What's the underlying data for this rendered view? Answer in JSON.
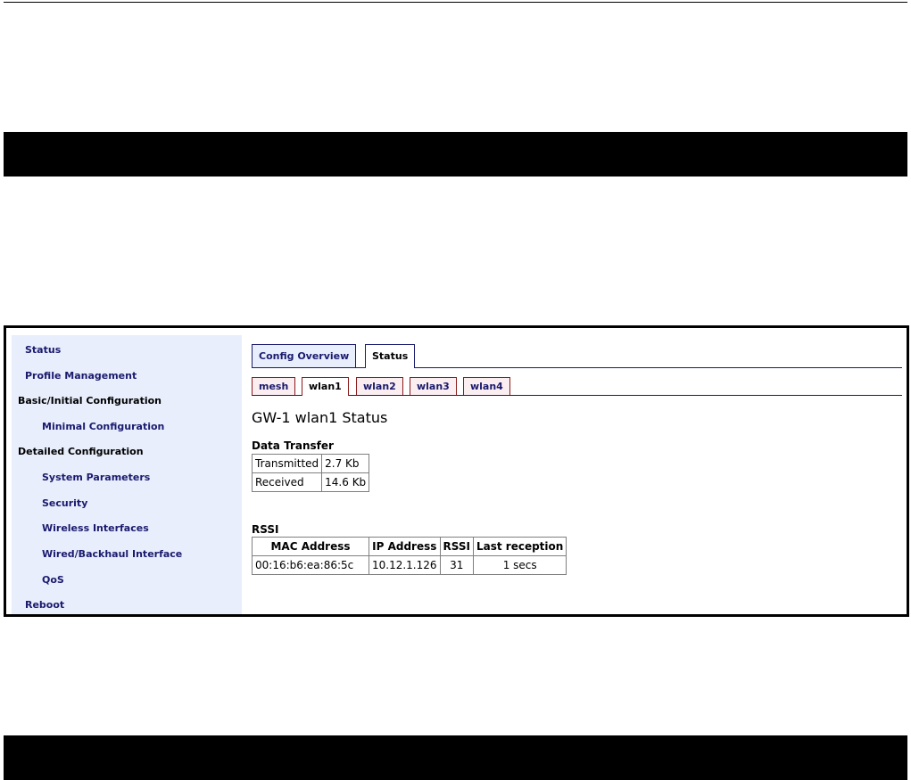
{
  "sidebar": {
    "items": [
      {
        "label": "Status"
      },
      {
        "label": "Profile Management"
      },
      {
        "label": "Basic/Initial Configuration"
      },
      {
        "label": "Minimal Configuration"
      },
      {
        "label": "Detailed Configuration"
      },
      {
        "label": "System Parameters"
      },
      {
        "label": "Security"
      },
      {
        "label": "Wireless Interfaces"
      },
      {
        "label": "Wired/Backhaul Interface"
      },
      {
        "label": "QoS"
      },
      {
        "label": "Reboot"
      }
    ]
  },
  "tabs": [
    {
      "label": "Config Overview"
    },
    {
      "label": "Status"
    }
  ],
  "active_tab": "Status",
  "subtabs": [
    {
      "label": "mesh"
    },
    {
      "label": "wlan1"
    },
    {
      "label": "wlan2"
    },
    {
      "label": "wlan3"
    },
    {
      "label": "wlan4"
    }
  ],
  "active_subtab": "wlan1",
  "page_title": "GW-1 wlan1 Status",
  "data_transfer": {
    "title": "Data Transfer",
    "rows": [
      {
        "label": "Transmitted",
        "value": "2.7 Kb"
      },
      {
        "label": "Received",
        "value": "14.6 Kb"
      }
    ]
  },
  "rssi": {
    "title": "RSSI",
    "headers": [
      "MAC Address",
      "IP Address",
      "RSSI",
      "Last reception"
    ],
    "rows": [
      [
        "00:16:b6:ea:86:5c",
        "10.12.1.126",
        "31",
        "1 secs"
      ]
    ]
  },
  "colors": {
    "sidebar_bg": "#e8eefc",
    "nav_text": "#1a1a6e",
    "subtab_border": "#8b1a1a"
  }
}
